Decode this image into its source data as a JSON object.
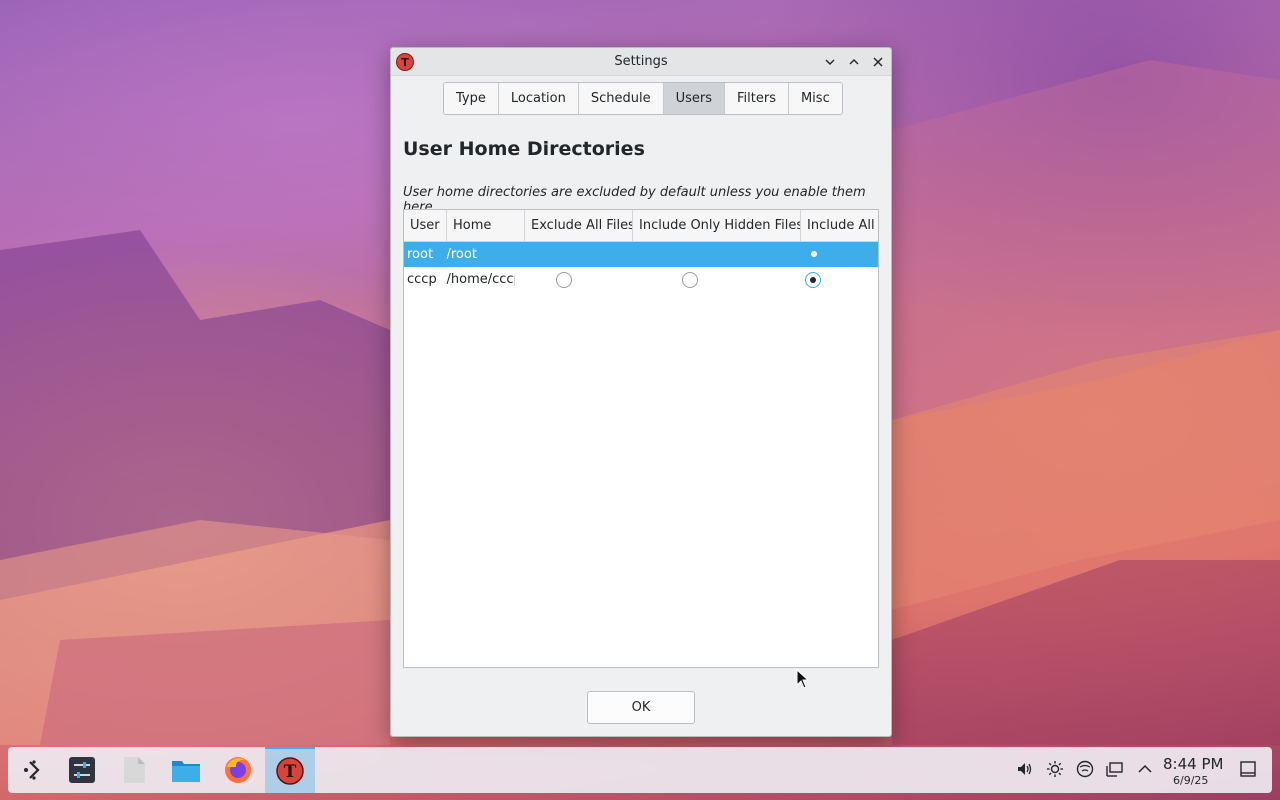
{
  "window": {
    "title": "Settings",
    "controls": {
      "minimize": "⌄",
      "maximize": "⌃",
      "close": "✕"
    }
  },
  "tabs": [
    {
      "label": "Type"
    },
    {
      "label": "Location"
    },
    {
      "label": "Schedule"
    },
    {
      "label": "Users",
      "active": true
    },
    {
      "label": "Filters"
    },
    {
      "label": "Misc"
    }
  ],
  "section": {
    "title": "User Home Directories",
    "description": "User home directories are excluded by default unless you enable them here"
  },
  "table": {
    "columns": [
      "User",
      "Home",
      "Exclude All Files",
      "Include Only Hidden Files",
      "Include All Files"
    ],
    "rows": [
      {
        "user": "root",
        "home": "/root",
        "selected": true,
        "choice": "Include All Files"
      },
      {
        "user": "cccp",
        "home": "/home/cccp",
        "selected": false,
        "choice": "Include All Files"
      }
    ]
  },
  "buttons": {
    "ok": "OK"
  },
  "taskbar": {
    "apps": [
      "application-launcher-icon",
      "settings-sliders-icon",
      "text-editor-icon",
      "file-manager-icon",
      "firefox-icon",
      "timeshift-icon"
    ],
    "tray": [
      "volume-icon",
      "brightness-icon",
      "network-icon",
      "display-icon",
      "expand-tray-icon"
    ],
    "time": "8:44 PM",
    "date": "6/9/25"
  },
  "colors": {
    "accent": "#3daee9",
    "window_bg": "#eff0f1"
  }
}
